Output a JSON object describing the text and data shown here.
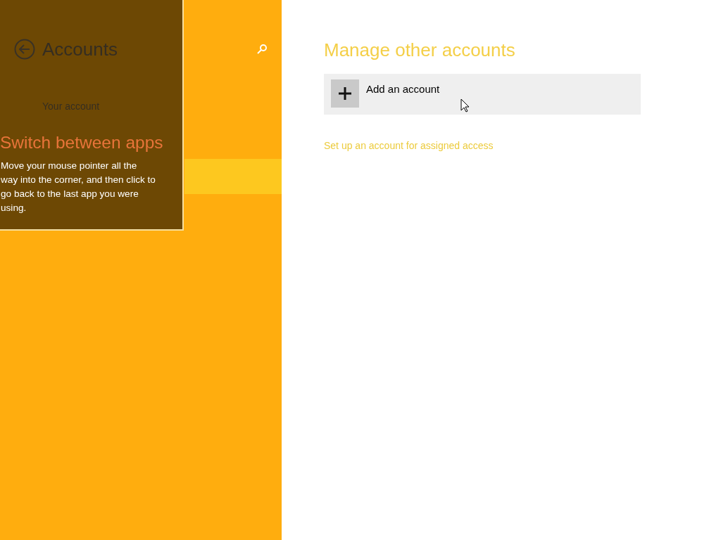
{
  "sidebar": {
    "title": "Accounts",
    "items": [
      {
        "label": "Your account",
        "selected": false
      },
      {
        "selected": true
      }
    ]
  },
  "tip": {
    "title": "Switch between apps",
    "text": "Move your mouse pointer all the way into the corner, and then click to go back to the last app you were using."
  },
  "main": {
    "title": "Manage other accounts",
    "add_button": "Add an account",
    "link": "Set up an account for assigned access"
  }
}
